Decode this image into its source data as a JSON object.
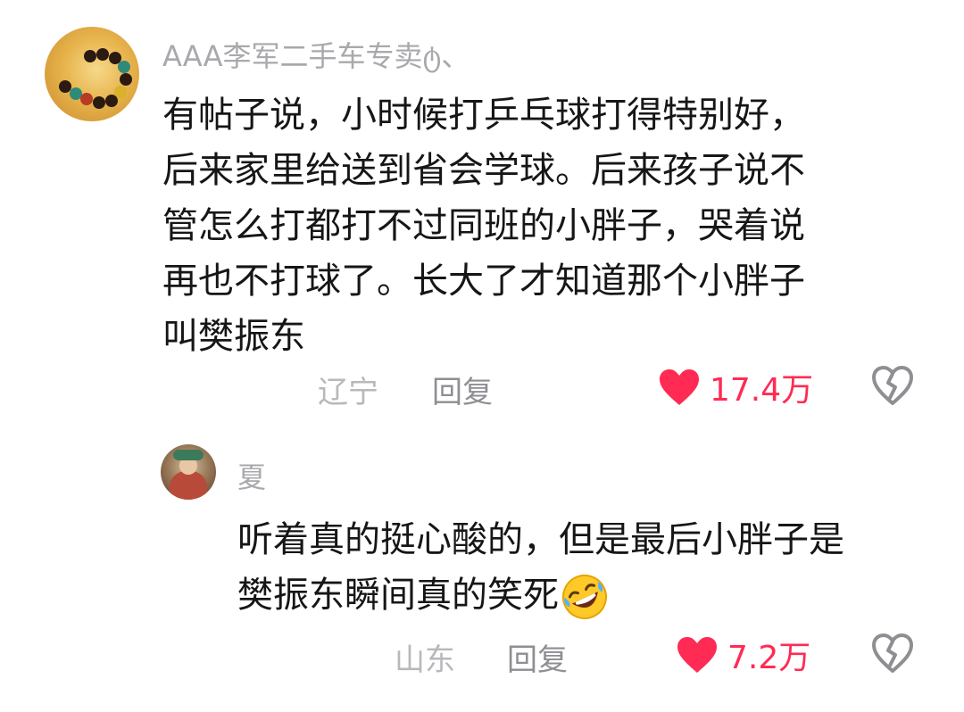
{
  "comments": [
    {
      "username": "AAA李军二手车专卖ტ、",
      "content_lines": [
        "有帖子说，小时候打乒乓球打得特别好，",
        "后来家里给送到省会学球。后来孩子说不",
        "管怎么打都打不过同班的小胖子，哭着说",
        "再也不打球了。长大了才知道那个小胖子",
        "叫樊振东"
      ],
      "location": "辽宁",
      "reply_label": "回复",
      "likes": "17.4万"
    },
    {
      "username": "夏",
      "content_lines": [
        "听着真的挺心酸的，但是最后小胖子是",
        "樊振东瞬间真的笑死"
      ],
      "emoji": "rolling-laughing-emoji",
      "location": "山东",
      "reply_label": "回复",
      "likes": "7.2万"
    }
  ],
  "colors": {
    "like": "#ff2b54",
    "username": "#a9a9ad",
    "text": "#161616",
    "meta": "#b8b8bc"
  },
  "icons": [
    "heart-icon",
    "broken-heart-icon"
  ]
}
